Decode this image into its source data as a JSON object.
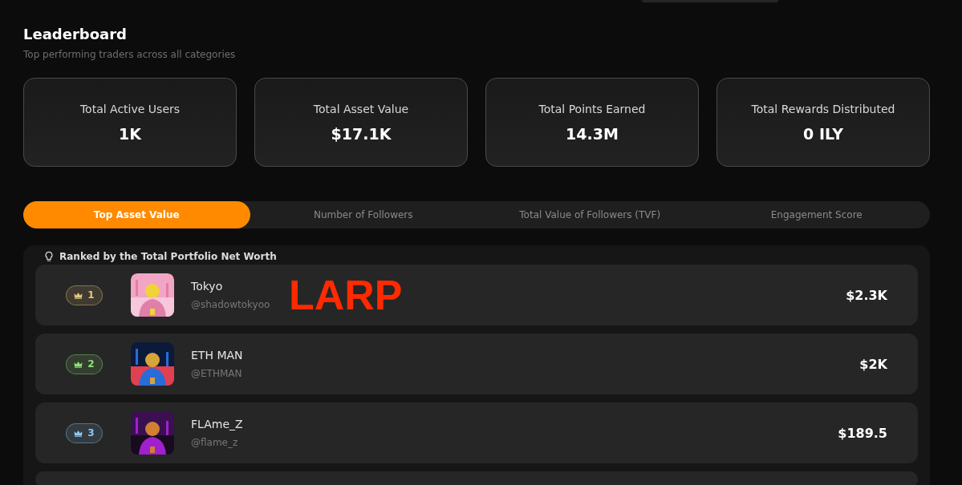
{
  "header": {
    "title": "Leaderboard",
    "subtitle": "Top performing traders across all categories"
  },
  "stats": [
    {
      "label": "Total Active Users",
      "value": "1K"
    },
    {
      "label": "Total Asset Value",
      "value": "$17.1K"
    },
    {
      "label": "Total Points Earned",
      "value": "14.3M"
    },
    {
      "label": "Total Rewards Distributed",
      "value": "0 ILY"
    }
  ],
  "tabs": [
    {
      "label": "Top Asset Value",
      "selected": true
    },
    {
      "label": "Number of Followers",
      "selected": false
    },
    {
      "label": "Total Value of Followers (TVF)",
      "selected": false
    },
    {
      "label": "Engagement Score",
      "selected": false
    }
  ],
  "ranking": {
    "note": "Ranked by the Total Portfolio Net Worth",
    "rows": [
      {
        "rank": "1",
        "color": "#e8c77a",
        "name": "Tokyo",
        "handle": "@shadowtokyoo",
        "value": "$2.3K"
      },
      {
        "rank": "2",
        "color": "#8fe07a",
        "name": "ETH MAN",
        "handle": "@ETHMAN",
        "value": "$2K"
      },
      {
        "rank": "3",
        "color": "#8cc8f0",
        "name": "FLAme_Z",
        "handle": "@flame_z",
        "value": "$189.5"
      }
    ]
  },
  "annotation": {
    "text": "LARP"
  }
}
